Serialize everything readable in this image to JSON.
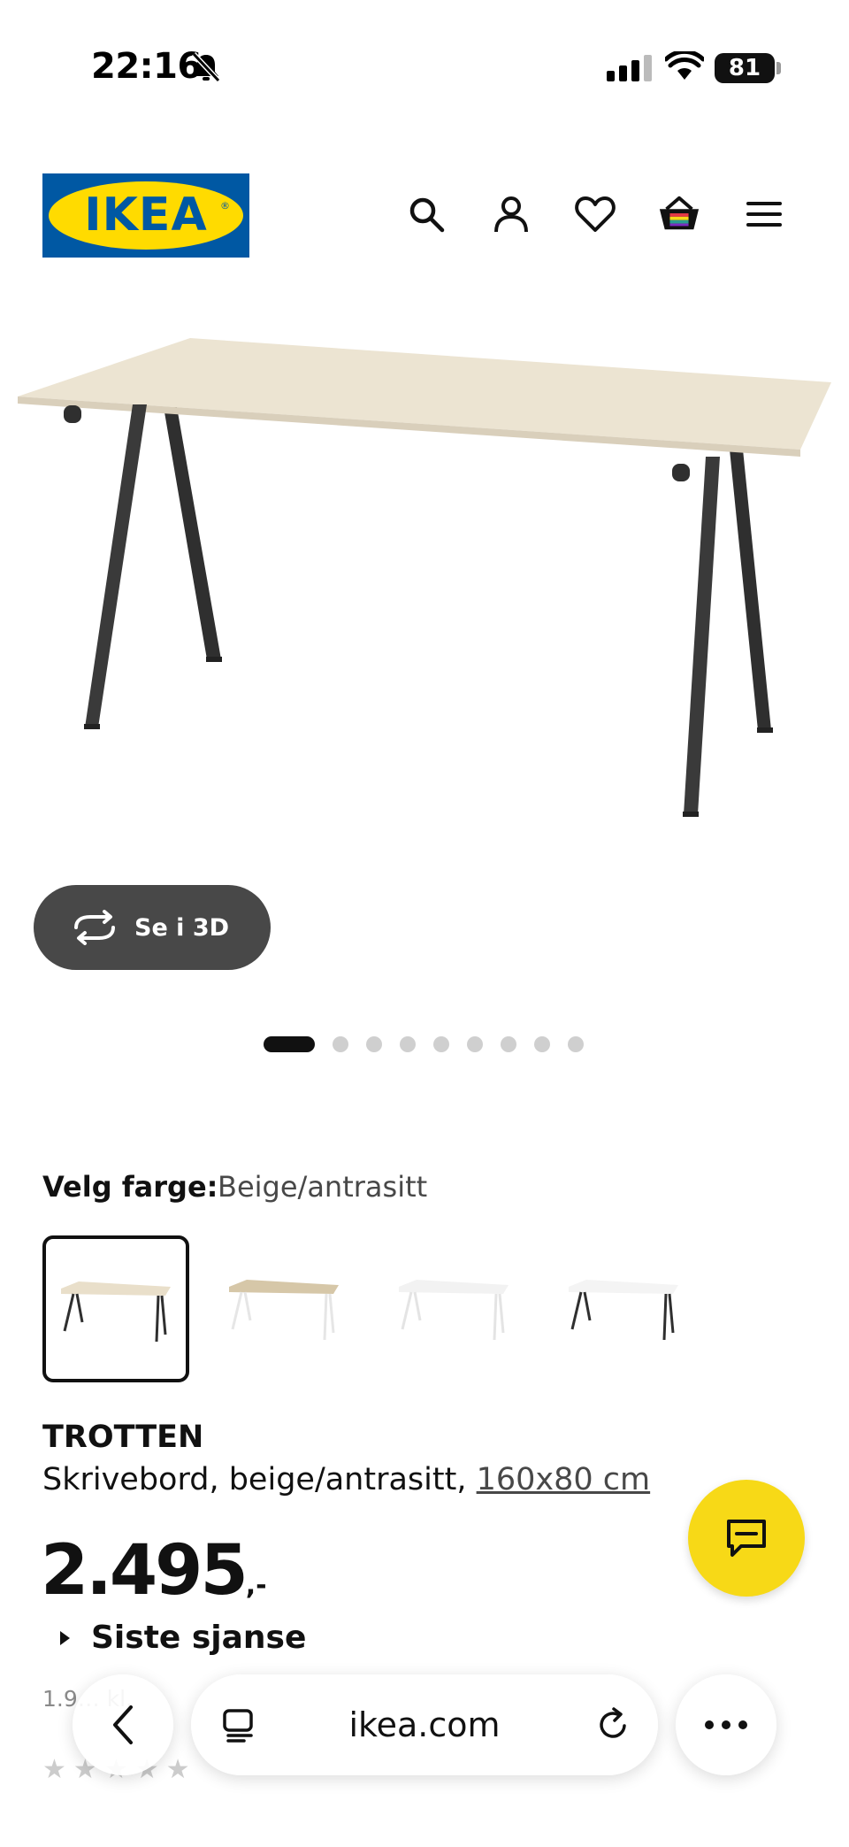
{
  "status_bar": {
    "time": "22:16",
    "battery": "81"
  },
  "header": {
    "logo_text": "IKEA",
    "icons": [
      "search-icon",
      "account-icon",
      "heart-icon",
      "basket-icon",
      "menu-icon"
    ]
  },
  "gallery": {
    "view_3d_label": "Se i 3D",
    "dots_total": 9,
    "active_index": 0
  },
  "color_picker": {
    "label": "Velg farge:",
    "selected_value": "Beige/antrasitt",
    "options": [
      "beige-anthracite",
      "beige-white",
      "white-white",
      "white-anthracite"
    ]
  },
  "product": {
    "name": "TROTTEN",
    "description": "Skrivebord, beige/antrasitt,",
    "dimensions": "160x80 cm",
    "price_main": "2.495",
    "price_suffix": ",-",
    "last_chance_label": "Siste sjanse",
    "small_text": "1.9… kl."
  },
  "browser": {
    "domain": "ikea.com"
  },
  "colors": {
    "ikea_blue": "#0058a3",
    "ikea_yellow": "#ffdb00",
    "chat_yellow": "#f7d917",
    "button_dark": "#484848"
  }
}
